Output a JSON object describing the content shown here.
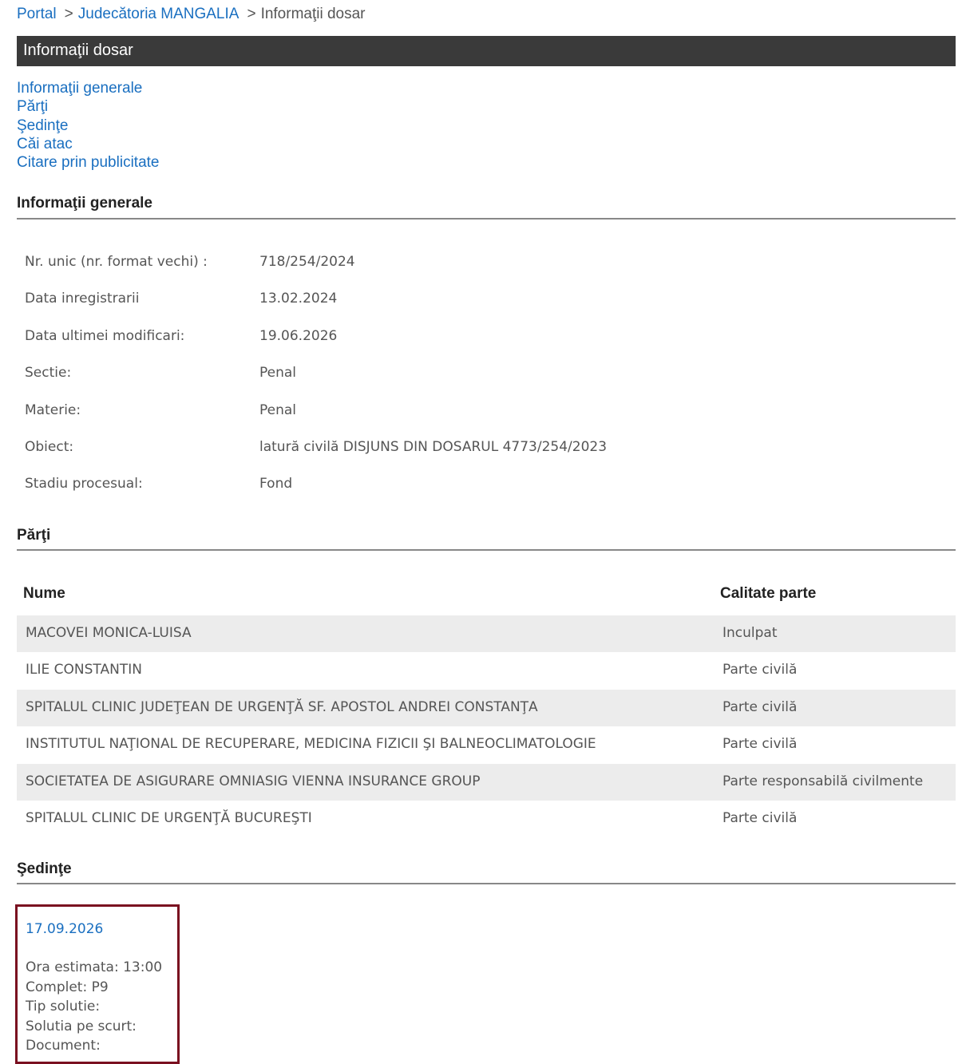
{
  "breadcrumb": {
    "portal": "Portal",
    "sep1": ">",
    "court": "Judecătoria MANGALIA",
    "sep2": ">",
    "current": "Informaţii dosar"
  },
  "title_bar": "Informaţii dosar",
  "anchors": [
    "Informaţii generale",
    "Părţi",
    "Şedinţe",
    "Căi atac",
    "Citare prin publicitate"
  ],
  "general": {
    "heading": "Informaţii generale",
    "rows": [
      {
        "label": "Nr. unic (nr. format vechi) :",
        "value": "718/254/2024"
      },
      {
        "label": "Data inregistrarii",
        "value": "13.02.2024"
      },
      {
        "label": "Data ultimei modificari:",
        "value": "19.06.2026"
      },
      {
        "label": "Sectie:",
        "value": "Penal"
      },
      {
        "label": "Materie:",
        "value": "Penal"
      },
      {
        "label": "Obiect:",
        "value": "latură civilă DISJUNS DIN DOSARUL 4773/254/2023"
      },
      {
        "label": "Stadiu procesual:",
        "value": "Fond"
      }
    ]
  },
  "parties": {
    "heading": "Părţi",
    "col_name": "Nume",
    "col_role": "Calitate parte",
    "rows": [
      {
        "name": "MACOVEI MONICA-LUISA",
        "role": "Inculpat"
      },
      {
        "name": "ILIE CONSTANTIN",
        "role": "Parte civilă"
      },
      {
        "name": "SPITALUL CLINIC JUDEŢEAN DE URGENŢĂ SF. APOSTOL ANDREI CONSTANŢA",
        "role": "Parte civilă"
      },
      {
        "name": "INSTITUTUL NAŢIONAL DE RECUPERARE, MEDICINA FIZICII ŞI BALNEOCLIMATOLOGIE",
        "role": "Parte civilă"
      },
      {
        "name": "SOCIETATEA DE ASIGURARE OMNIASIG VIENNA INSURANCE GROUP",
        "role": "Parte responsabilă civilmente"
      },
      {
        "name": "SPITALUL CLINIC DE URGENŢĂ BUCUREŞTI",
        "role": "Parte civilă"
      }
    ]
  },
  "sessions": {
    "heading": "Şedinţe",
    "items": [
      {
        "date": "17.09.2026",
        "details": [
          "Ora estimata: 13:00",
          "Complet: P9",
          "Tip solutie:",
          "Solutia pe scurt:",
          "Document:"
        ]
      }
    ]
  },
  "colors": {
    "link": "#1a6fc0",
    "title_bar": "#3a3a3a",
    "session_border": "#7a1020",
    "row_stripe": "#ececec"
  }
}
